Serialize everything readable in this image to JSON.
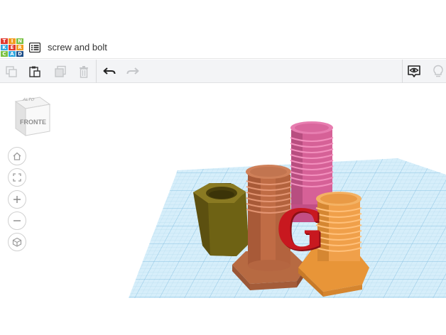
{
  "app": {
    "logo_letters": [
      "T",
      "I",
      "N",
      "K",
      "E",
      "R",
      "C",
      "A",
      "D"
    ],
    "logo_colors": [
      "#e03a2f",
      "#f29b1f",
      "#7ac143",
      "#31a8e0",
      "#e03a2f",
      "#f29b1f",
      "#7ac143",
      "#31a8e0",
      "#1d4e89"
    ],
    "design_title": "screw and bolt"
  },
  "toolbar": {
    "buttons": [
      {
        "name": "copy-button",
        "icon": "copy-icon",
        "enabled": false
      },
      {
        "name": "paste-button",
        "icon": "paste-icon",
        "enabled": true
      },
      {
        "name": "duplicate-button",
        "icon": "duplicate-icon",
        "enabled": false
      },
      {
        "name": "delete-button",
        "icon": "trash-icon",
        "enabled": false
      },
      {
        "name": "undo-button",
        "icon": "undo-icon",
        "enabled": true
      },
      {
        "name": "redo-button",
        "icon": "redo-icon",
        "enabled": false
      }
    ],
    "right_buttons": [
      {
        "name": "notes-visibility-button",
        "icon": "eye-speech-icon",
        "enabled": true
      },
      {
        "name": "light-bulb-button",
        "icon": "light-bulb-icon",
        "enabled": false
      }
    ]
  },
  "viewcube": {
    "top_label": "ALTO",
    "front_label": "FRONTE"
  },
  "nav_controls": [
    {
      "name": "home-view-button",
      "icon": "home-icon"
    },
    {
      "name": "fit-view-button",
      "icon": "fit-icon"
    },
    {
      "name": "zoom-in-button",
      "icon": "plus-icon"
    },
    {
      "name": "zoom-out-button",
      "icon": "minus-icon"
    },
    {
      "name": "perspective-button",
      "icon": "cube-icon"
    }
  ],
  "scene": {
    "letter": "G",
    "colors": {
      "grid_plane": "#d4ecf8",
      "grid_line": "#a8d4ec",
      "olive_nut": "#6b5e14",
      "copper_bolt": "#c96f4a",
      "pink_bolt": "#e06aa0",
      "orange_bolt": "#f0a04a",
      "red_letter": "#c8181f"
    }
  }
}
